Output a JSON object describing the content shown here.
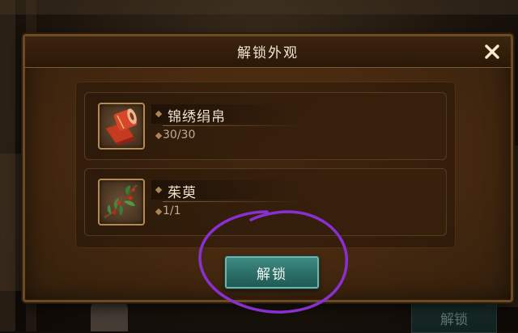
{
  "dialog": {
    "title": "解锁外观",
    "close_icon": "close-x-icon"
  },
  "items": [
    {
      "name": "锦绣绢帛",
      "count": "30/30",
      "icon": "silk-scroll-icon"
    },
    {
      "name": "茱萸",
      "count": "1/1",
      "icon": "dogwood-branch-icon"
    }
  ],
  "actions": {
    "unlock_label": "解锁"
  },
  "background": {
    "unlock_label": "解锁"
  },
  "colors": {
    "accent": "#2b6e67",
    "annotation": "#8a2fd1",
    "frame": "#6b4a25"
  }
}
